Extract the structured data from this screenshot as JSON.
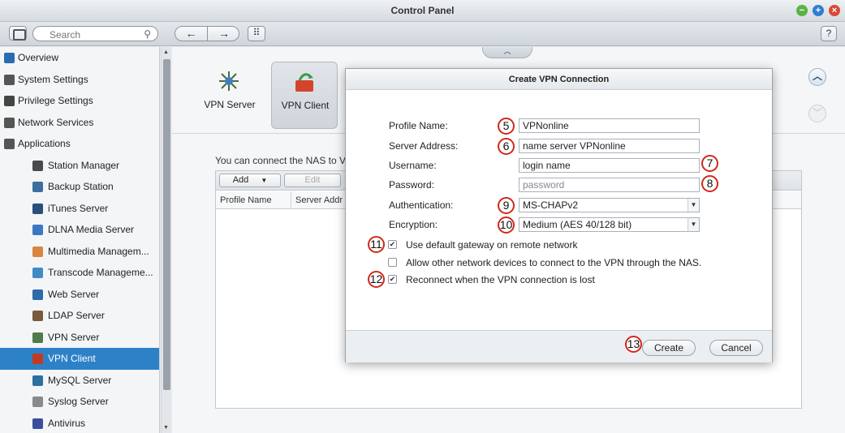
{
  "window": {
    "title": "Control Panel",
    "min_glyph": "−",
    "max_glyph": "+",
    "close_glyph": "×"
  },
  "toolbar": {
    "search_placeholder": "Search",
    "help_label": "?"
  },
  "sidebar": {
    "items": [
      {
        "label": "Overview",
        "level": "top",
        "icon": "overview-icon",
        "color": "#2b6cb0"
      },
      {
        "label": "System Settings",
        "level": "top",
        "icon": "gear-icon",
        "color": "#555555"
      },
      {
        "label": "Privilege Settings",
        "level": "top",
        "icon": "user-icon",
        "color": "#444444"
      },
      {
        "label": "Network Services",
        "level": "top",
        "icon": "network-icon",
        "color": "#555555"
      },
      {
        "label": "Applications",
        "level": "top",
        "icon": "applications-icon",
        "color": "#555555"
      },
      {
        "label": "Station Manager",
        "level": "sub",
        "icon": "station-manager-icon",
        "color": "#4a4a4a"
      },
      {
        "label": "Backup Station",
        "level": "sub",
        "icon": "backup-station-icon",
        "color": "#3d6f9e"
      },
      {
        "label": "iTunes Server",
        "level": "sub",
        "icon": "itunes-server-icon",
        "color": "#2a4f7a"
      },
      {
        "label": "DLNA Media Server",
        "level": "sub",
        "icon": "dlna-media-server-icon",
        "color": "#3a79c2"
      },
      {
        "label": "Multimedia Managem...",
        "level": "sub",
        "icon": "multimedia-management-icon",
        "color": "#d98540"
      },
      {
        "label": "Transcode Manageme...",
        "level": "sub",
        "icon": "transcode-management-icon",
        "color": "#3f8bc7"
      },
      {
        "label": "Web Server",
        "level": "sub",
        "icon": "web-server-icon",
        "color": "#2c6aa8"
      },
      {
        "label": "LDAP Server",
        "level": "sub",
        "icon": "ldap-server-icon",
        "color": "#7a5a3c"
      },
      {
        "label": "VPN Server",
        "level": "sub",
        "icon": "vpn-server-icon",
        "color": "#4f7a4a"
      },
      {
        "label": "VPN Client",
        "level": "sub",
        "icon": "vpn-client-icon",
        "color": "#c23a22",
        "active": true
      },
      {
        "label": "MySQL Server",
        "level": "sub",
        "icon": "mysql-server-icon",
        "color": "#2d6fa0"
      },
      {
        "label": "Syslog Server",
        "level": "sub",
        "icon": "syslog-server-icon",
        "color": "#8a8a8a"
      },
      {
        "label": "Antivirus",
        "level": "sub",
        "icon": "antivirus-icon",
        "color": "#3a4f9a"
      }
    ]
  },
  "main": {
    "tabs": [
      {
        "label": "VPN Server",
        "icon": "vpn-server-tab-icon"
      },
      {
        "label": "VPN Client",
        "icon": "vpn-client-tab-icon"
      }
    ],
    "description": "You can connect the NAS to V",
    "list": {
      "add_label": "Add",
      "edit_label": "Edit",
      "columns": [
        "Profile Name",
        "Server Addr"
      ]
    }
  },
  "dialog": {
    "title": "Create VPN Connection",
    "fields": {
      "profile_name": {
        "label": "Profile Name:",
        "value": "VPNonline",
        "callout": "5"
      },
      "server_address": {
        "label": "Server Address:",
        "value": "name server VPNonline",
        "callout": "6"
      },
      "username": {
        "label": "Username:",
        "value": "login name",
        "callout": "7"
      },
      "password": {
        "label": "Password:",
        "placeholder": "password",
        "callout": "8"
      },
      "authentication": {
        "label": "Authentication:",
        "value": "MS-CHAPv2",
        "callout": "9"
      },
      "encryption": {
        "label": "Encryption:",
        "value": "Medium (AES 40/128 bit)",
        "callout": "10"
      }
    },
    "options": [
      {
        "label": "Use default gateway on remote network",
        "checked": true,
        "callout": "11"
      },
      {
        "label": "Allow other network devices to connect to the VPN through the NAS.",
        "checked": false,
        "callout": ""
      },
      {
        "label": "Reconnect when the VPN connection is lost",
        "checked": true,
        "callout": "12"
      }
    ],
    "create_label": "Create",
    "create_callout": "13",
    "cancel_label": "Cancel"
  },
  "colors": {
    "accent": "#2d82c7",
    "callout_border": "#d0291a"
  }
}
